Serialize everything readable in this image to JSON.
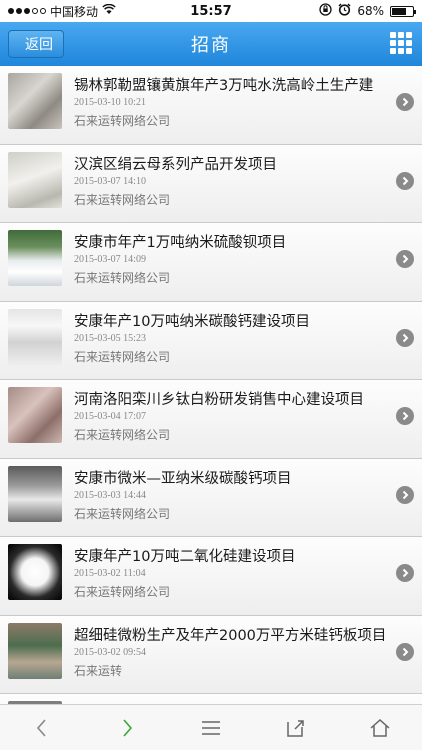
{
  "status": {
    "carrier": "中国移动",
    "time": "15:57",
    "battery": "68%",
    "battery_level": 0.68
  },
  "nav": {
    "back_label": "返回",
    "title": "招商",
    "menu_icon": "grid-icon"
  },
  "items": [
    {
      "title": "锡林郭勒盟镶黄旗年产3万吨水洗高岭土生产建",
      "date": "2015-03-10 10:21",
      "source": "石来运转网络公司",
      "thumb": "linear-gradient(135deg,#a9a59f 0%,#d9d6d1 40%,#8f8a83 70%,#c8c4bd 100%)"
    },
    {
      "title": "汉滨区绢云母系列产品开发项目",
      "date": "2015-03-07 14:10",
      "source": "石来运转网络公司",
      "thumb": "linear-gradient(160deg,#cfcfc9 0%,#f1f0ec 45%,#b9b8b0 80%,#e2e1db 100%)"
    },
    {
      "title": "安康市年产1万吨纳米硫酸钡项目",
      "date": "2015-03-07 14:09",
      "source": "石来运转网络公司",
      "thumb": "linear-gradient(180deg,#3f6b3a 0%,#6a8f5d 30%,#e9ecee 55%,#ffffff 75%,#cfd6da 100%)"
    },
    {
      "title": "安康年产10万吨纳米碳酸钙建设项目",
      "date": "2015-03-05 15:23",
      "source": "石来运转网络公司",
      "thumb": "linear-gradient(180deg,#e5e5e5 0%,#f7f7f7 30%,#d2d2d2 60%,#eeeeee 100%)"
    },
    {
      "title": "河南洛阳栾川乡钛白粉研发销售中心建设项目",
      "date": "2015-03-04 17:07",
      "source": "石来运转网络公司",
      "thumb": "linear-gradient(135deg,#a58c86 0%,#d9c2bd 40%,#8d6f69 70%,#cdb7b2 100%)"
    },
    {
      "title": "安康市微米—亚纳米级碳酸钙项目",
      "date": "2015-03-03 14:44",
      "source": "石来运转网络公司",
      "thumb": "linear-gradient(180deg,#5a5a5a 0%,#9a9a9a 35%,#e8e8e8 60%,#6e6e6e 100%)"
    },
    {
      "title": "安康年产10万吨二氧化硅建设项目",
      "date": "2015-03-02 11:04",
      "source": "石来运转网络公司",
      "thumb": "radial-gradient(circle at 50% 50%,#ffffff 0%,#f5f5f5 35%,#2a2a2a 65%,#000000 100%)"
    },
    {
      "title": "超细硅微粉生产及年产2000万平方米硅钙板项目",
      "date": "2015-03-02 09:54",
      "source": "石来运转",
      "thumb": "linear-gradient(180deg,#8c7a68 0%,#4d6d4e 40%,#b7a792 70%,#6f7f73 100%)"
    }
  ],
  "toolbar": {
    "back_icon": "chevron-left-icon",
    "forward_icon": "chevron-right-icon",
    "menu_icon": "menu-icon",
    "share_icon": "share-icon",
    "home_icon": "home-icon"
  }
}
